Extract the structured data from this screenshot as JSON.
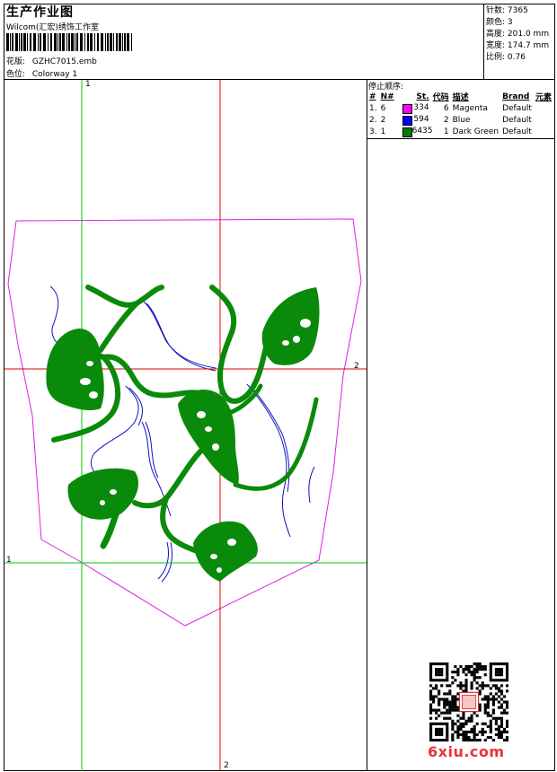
{
  "header": {
    "title": "生产作业图",
    "company": "Wilcom(汇宏)绣饰工作室",
    "design_label": "花版:",
    "design_value": "GZHC7015.emb",
    "colorway_label": "色位:",
    "colorway_value": "Colorway 1"
  },
  "stats": [
    {
      "label": "针数:",
      "value": "7365"
    },
    {
      "label": "颜色:",
      "value": "3"
    },
    {
      "label": "高度:",
      "value": "201.0 mm"
    },
    {
      "label": "宽度:",
      "value": "174.7 mm"
    },
    {
      "label": "比例:",
      "value": "0.76"
    }
  ],
  "stop_sequence": {
    "title": "停止顺序:",
    "columns": [
      "#",
      "N#",
      "St.",
      "代码",
      "描述",
      "Brand",
      "元素"
    ],
    "rows": [
      {
        "idx": "1.",
        "n": "6",
        "color": "#ff00ff",
        "st": "334",
        "code": "6",
        "desc": "Magenta",
        "brand": "Default",
        "elem": ""
      },
      {
        "idx": "2.",
        "n": "2",
        "color": "#0000ff",
        "st": "594",
        "code": "2",
        "desc": "Blue",
        "brand": "Default",
        "elem": ""
      },
      {
        "idx": "3.",
        "n": "1",
        "color": "#008000",
        "st": "6435",
        "code": "1",
        "desc": "Dark Green",
        "brand": "Default",
        "elem": ""
      }
    ]
  },
  "canvas_labels": {
    "green_top": "1",
    "green_left": "1",
    "red_right": "2",
    "red_bottom": "2"
  },
  "colors": {
    "magenta": "#e020e0",
    "blue": "#1010c0",
    "green": "#0a8a0a",
    "guide_green": "#00c800",
    "guide_red": "#e00000"
  },
  "watermark": "6xiu.com"
}
